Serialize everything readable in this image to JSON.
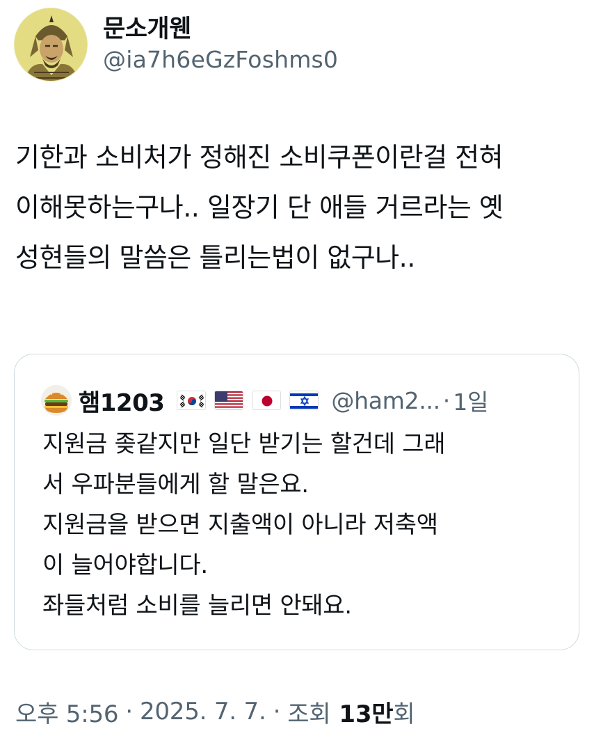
{
  "author": {
    "display_name": "문소개웬",
    "handle": "@ia7h6eGzFoshms0",
    "avatar_icon": "ancient-warrior-avatar-icon"
  },
  "tweet": {
    "text": "기한과 소비처가 정해진 소비쿠폰이란걸 전혀 이해못하는구나.. 일장기 단 애들 거르라는 옛 성현들의 말씀은 틀리는법이 없구나.."
  },
  "quoted": {
    "avatar_icon": "burger-avatar-icon",
    "display_name": "햄1203",
    "flags": [
      "kr-flag-icon",
      "us-flag-icon",
      "jp-flag-icon",
      "il-flag-icon"
    ],
    "handle": "@ham2...",
    "separator": "·",
    "time": "1일",
    "lines": [
      "지원금 좆같지만 일단 받기는 할건데 그래",
      "서 우파분들에게 할 말은요.",
      "지원금을 받으면 지출액이 아니라 저축액",
      "이 늘어야합니다.",
      "좌들처럼 소비를 늘리면 안돼요."
    ]
  },
  "meta": {
    "time": "오후 5:56",
    "dot1": "·",
    "date": "2025. 7. 7.",
    "dot2": "·",
    "views_label": "조회",
    "views_count": "13만",
    "views_suffix": "회"
  },
  "colors": {
    "text": "#0f1419",
    "secondary": "#536471",
    "border": "#cfd9de",
    "avatar_bg": "#e3dc83"
  }
}
